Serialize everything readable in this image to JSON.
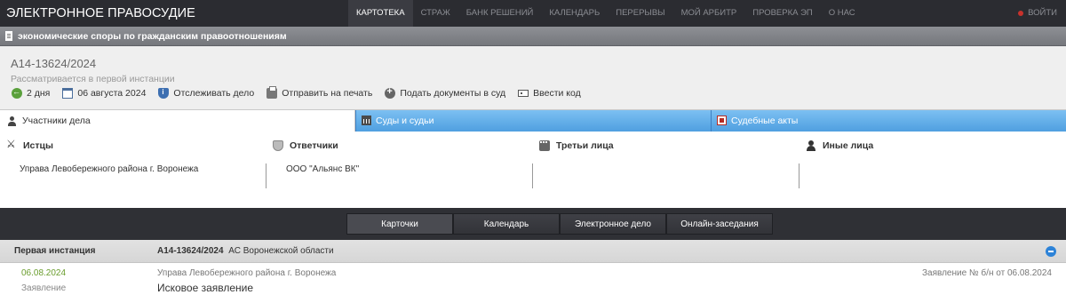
{
  "app": {
    "title": "ЭЛЕКТРОННОЕ ПРАВОСУДИЕ",
    "login_label": "ВОЙТИ"
  },
  "nav": [
    {
      "label": "КАРТОТЕКА",
      "active": true
    },
    {
      "label": "СТРАЖ"
    },
    {
      "label": "БАНК РЕШЕНИЙ"
    },
    {
      "label": "КАЛЕНДАРЬ"
    },
    {
      "label": "ПЕРЕРЫВЫ"
    },
    {
      "label": "МОЙ АРБИТР"
    },
    {
      "label": "ПРОВЕРКА ЭП"
    },
    {
      "label": "О НАС"
    }
  ],
  "category": {
    "label": "экономические споры по гражданским правоотношениям"
  },
  "case": {
    "number": "А14-13624/2024",
    "status": "Рассматривается в первой инстанции",
    "actions": {
      "days": "2 дня",
      "date": "06 августа 2024",
      "track": "Отслеживать дело",
      "print": "Отправить на печать",
      "submit": "Подать документы в суд",
      "code": "Ввести код"
    }
  },
  "tabs": {
    "participants": "Участники дела",
    "courts": "Суды и судьи",
    "acts": "Судебные акты"
  },
  "participants": {
    "plaintiffs": {
      "label": "Истцы",
      "items": [
        "Управа Левобережного района г. Воронежа"
      ]
    },
    "defendants": {
      "label": "Ответчики",
      "items": [
        "ООО \"Альянс ВК\""
      ]
    },
    "third": {
      "label": "Третьи лица",
      "items": []
    },
    "other": {
      "label": "Иные лица",
      "items": []
    }
  },
  "subtabs": [
    {
      "label": "Карточки",
      "active": true
    },
    {
      "label": "Календарь"
    },
    {
      "label": "Электронное дело"
    },
    {
      "label": "Онлайн-заседания"
    }
  ],
  "instance": {
    "title": "Первая инстанция",
    "case_number": "А14-13624/2024",
    "court": "АС Воронежской области"
  },
  "document": {
    "date": "06.08.2024",
    "type": "Заявление",
    "organization": "Управа Левобережного района г. Воронежа",
    "title": "Исковое заявление",
    "reference": "Заявление № б/н от 06.08.2024"
  }
}
